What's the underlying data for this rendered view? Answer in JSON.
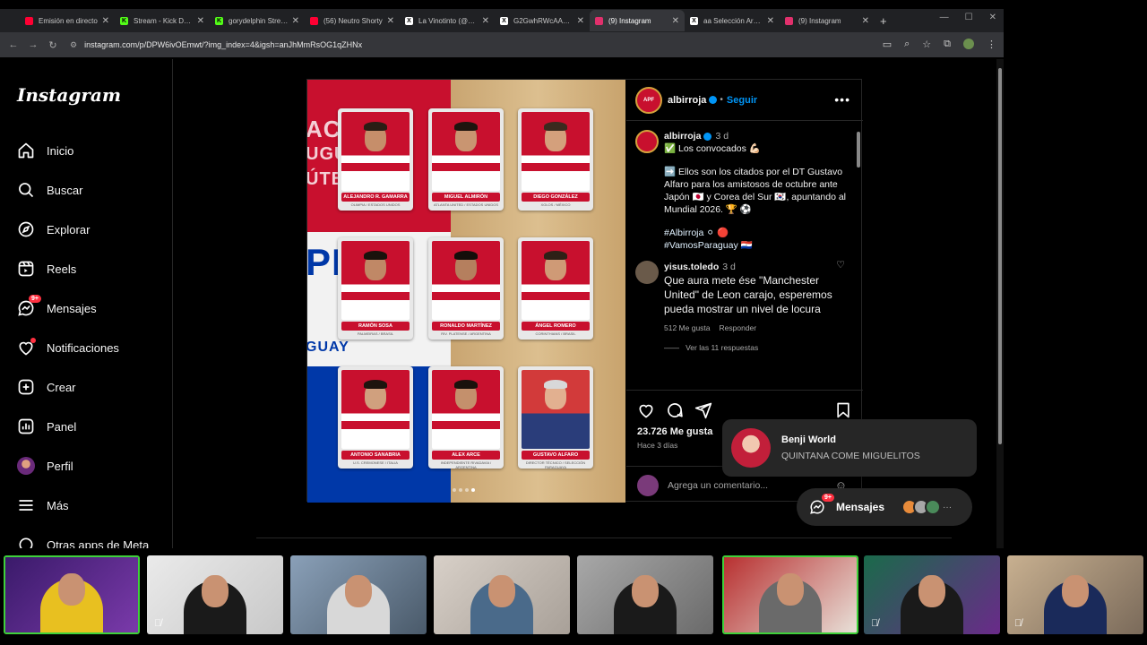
{
  "browser": {
    "tabs": [
      {
        "title": "Emisión en directo",
        "fav_color": "#ff0033",
        "fav_letter": ""
      },
      {
        "title": "Stream - Kick Dashb",
        "fav_color": "#53fc18",
        "fav_letter": "K"
      },
      {
        "title": "gorydelphin Stream",
        "fav_color": "#53fc18",
        "fav_letter": "K"
      },
      {
        "title": "(56) Neutro Shorty",
        "fav_color": "#ff0033",
        "fav_letter": ""
      },
      {
        "title": "La Vinotinto (@Sele",
        "fav_color": "#ffffff",
        "fav_letter": "X"
      },
      {
        "title": "G2GwhRWcAAoCq",
        "fav_color": "#ffffff",
        "fav_letter": "X"
      },
      {
        "title": "(9) Instagram",
        "fav_color": "#e1306c",
        "fav_letter": "",
        "active": true
      },
      {
        "title": "aa Selección Argen",
        "fav_color": "#ffffff",
        "fav_letter": "X"
      },
      {
        "title": "(9) Instagram",
        "fav_color": "#e1306c",
        "fav_letter": ""
      }
    ],
    "new_tab": "+",
    "url": "instagram.com/p/DPW6ivOEmwt/?img_index=4&igsh=anJhMmRsOG1qZHNx"
  },
  "sidebar": {
    "logo": "Instagram",
    "items": [
      {
        "label": "Inicio",
        "icon": "home-icon"
      },
      {
        "label": "Buscar",
        "icon": "search-icon"
      },
      {
        "label": "Explorar",
        "icon": "compass-icon"
      },
      {
        "label": "Reels",
        "icon": "reels-icon"
      },
      {
        "label": "Mensajes",
        "icon": "messenger-icon",
        "badge": "9+"
      },
      {
        "label": "Notificaciones",
        "icon": "heart-icon",
        "dot": true
      },
      {
        "label": "Crear",
        "icon": "plus-square-icon"
      },
      {
        "label": "Panel",
        "icon": "dashboard-icon"
      },
      {
        "label": "Perfil",
        "icon": "profile-avatar-icon"
      },
      {
        "label": "Más",
        "icon": "menu-icon"
      },
      {
        "label": "Otras apps de Meta",
        "icon": "meta-apps-icon"
      }
    ]
  },
  "post": {
    "image_text": {
      "left_top": [
        "ACI",
        "UGUA",
        "ÚTBO"
      ],
      "left_mid": "PF",
      "left_bottom": "GUAY"
    },
    "cards": [
      {
        "name": "ALEJANDRO R. GAMARRA",
        "club": "OLIMPIA / ESTADOS UNIDOS"
      },
      {
        "name": "MIGUEL ALMIRÓN",
        "club": "ATLANTA UNITED / ESTADOS UNIDOS"
      },
      {
        "name": "DIEGO GONZÁLEZ",
        "club": "XOLOS / MÉXICO"
      },
      {
        "name": "RAMÓN SOSA",
        "club": "PALMEIRAS / BRASIL"
      },
      {
        "name": "RONALDO MARTÍNEZ",
        "club": "RIV. PLATENSE / ARGENTINA"
      },
      {
        "name": "ÁNGEL ROMERO",
        "club": "CORINTHIANS / BRASIL"
      },
      {
        "name": "ANTONIO SANABRIA",
        "club": "U.S. CREMONESE / ITALIA"
      },
      {
        "name": "ALEX ARCE",
        "club": "INDEPENDIENTE RIVADAVIA / ARGENTINA"
      },
      {
        "name": "GUSTAVO ALFARO",
        "club": "DIRECTOR TÉCNICO / SELECCIÓN PARAGUAYA"
      }
    ],
    "header": {
      "avatar_text": "APF",
      "username": "albirroja",
      "separator": "•",
      "follow": "Seguir",
      "more": "•••"
    },
    "caption": {
      "username": "albirroja",
      "time": "3 d",
      "line1": "✅ Los convocados 💪🏻",
      "line2": "➡️ Ellos son los citados por el DT Gustavo Alfaro para los amistosos de octubre ante Japón 🇯🇵 y Corea del Sur 🇰🇷, apuntando al Mundial 2026. 🏆 ⚽",
      "tags1": "#Albirroja ⚪ 🔴",
      "tags2": "#VamosParaguay 🇵🇾"
    },
    "comment": {
      "username": "yisus.toledo",
      "time": "3 d",
      "text": "Que aura mete ése \"Manchester United\" de Leon carajo, esperemos pueda mostrar un nivel de locura",
      "likes": "512 Me gusta",
      "reply": "Responder",
      "replies": "Ver las 11 respuestas"
    },
    "likes": "23.726 Me gusta",
    "ago": "Hace 3 días",
    "add_comment_placeholder": "Agrega un comentario..."
  },
  "toast": {
    "name": "Benji World",
    "message": "QUINTANA COME MIGUELITOS"
  },
  "messages_pill": {
    "label": "Mensajes",
    "badge": "9+",
    "more": "···"
  },
  "colors": {
    "accent_blue": "#0095f6",
    "badge_red": "#ff3040",
    "speaking_green": "#3fd13a"
  }
}
